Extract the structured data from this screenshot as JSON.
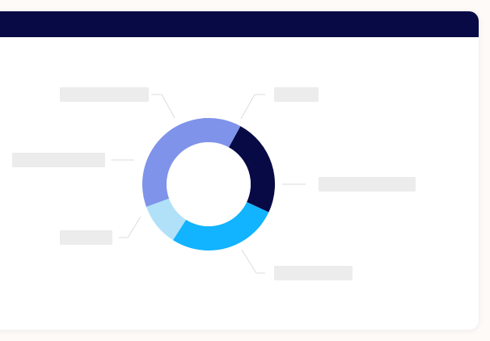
{
  "card": {
    "header_color": "#070a45"
  },
  "chart_data": {
    "type": "pie",
    "variant": "donut",
    "title": "",
    "legend": "none",
    "labels_visible": false,
    "slices": [
      {
        "value": 37,
        "color": "#7f93ea"
      },
      {
        "value": 23,
        "color": "#070a45"
      },
      {
        "value": 26,
        "color": "#12b3ff"
      },
      {
        "value": 10,
        "color": "#b0e1f8"
      }
    ]
  }
}
